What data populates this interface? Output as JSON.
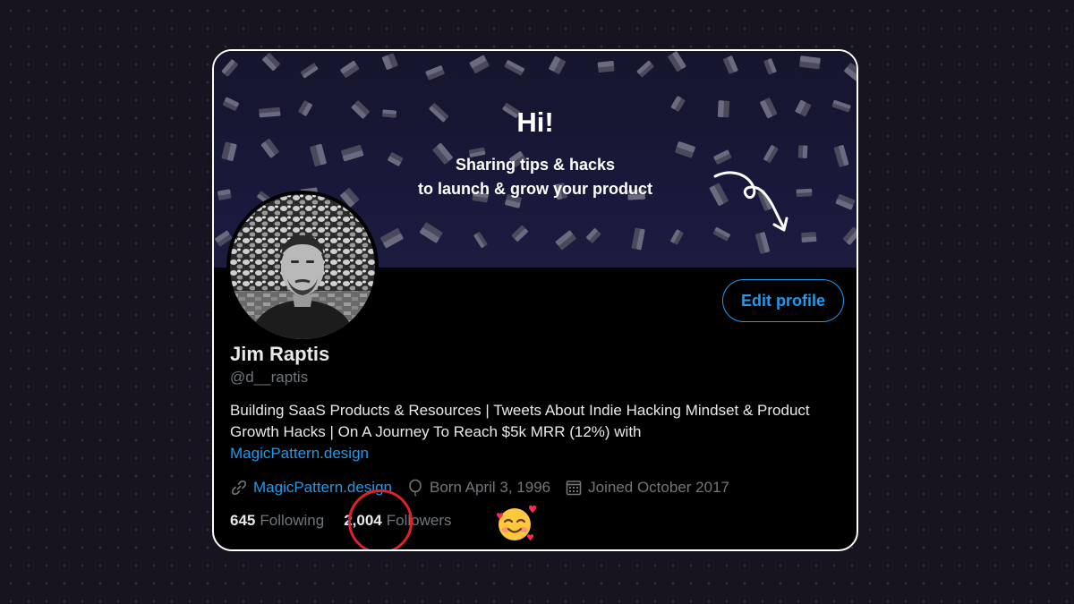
{
  "banner": {
    "greeting": "Hi!",
    "tagline_line1": "Sharing tips & hacks",
    "tagline_line2": "to launch & grow your product"
  },
  "profile": {
    "name": "Jim Raptis",
    "handle": "@d__raptis",
    "edit_button_label": "Edit profile",
    "bio_text": "Building SaaS Products & Resources | Tweets About Indie Hacking Mindset & Product Growth Hacks | On A Journey To Reach $5k MRR (12%) with",
    "bio_link": "MagicPattern.design",
    "website": "MagicPattern.design",
    "birthday": "Born April 3, 1996",
    "joined": "Joined October 2017",
    "following_count": "645",
    "following_label": "Following",
    "followers_count": "2,004",
    "followers_label": "Followers"
  },
  "icons": {
    "website": "link-icon",
    "birthday": "balloon-icon",
    "joined": "calendar-icon",
    "emoji": "smiling-face-with-hearts"
  },
  "colors": {
    "accent": "#1d9bf0",
    "highlight_circle": "#e0202a",
    "card_background": "#000000",
    "page_background": "#17131f"
  }
}
